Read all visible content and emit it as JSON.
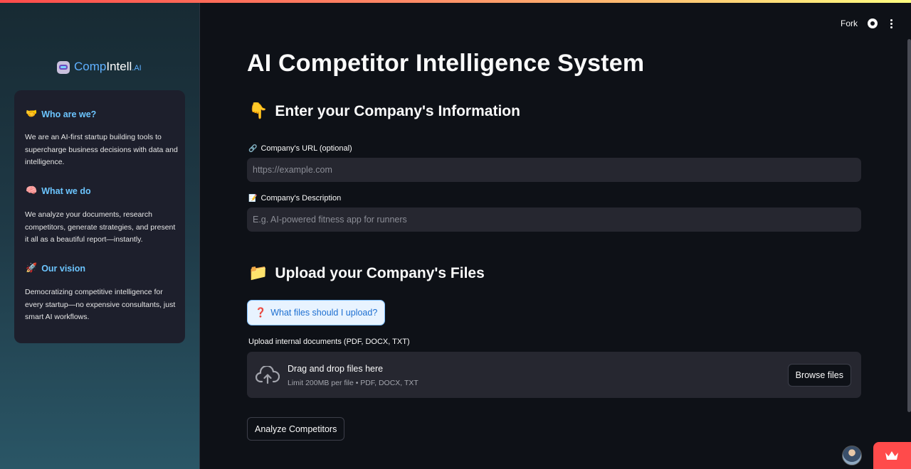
{
  "window": {
    "accent_bar_colors": [
      "#ff4b4b",
      "#fffd80"
    ]
  },
  "header": {
    "fork_label": "Fork",
    "github_icon": "github-icon",
    "menu_icon": "more-vertical-icon"
  },
  "sidebar": {
    "logo": {
      "comp": "Comp",
      "intell": "Intell",
      "ai": ".AI"
    },
    "sections": [
      {
        "emoji": "🤝",
        "heading": "Who are we?",
        "text": "We are an AI-first startup building tools to supercharge business decisions with data and intelligence."
      },
      {
        "emoji": "🧠",
        "heading": "What we do",
        "text": "We analyze your documents, research competitors, generate strategies, and present it all as a beautiful report—instantly."
      },
      {
        "emoji": "🚀",
        "heading": "Our vision",
        "text": "Democratizing competitive intelligence for every startup—no expensive consultants, just smart AI workflows."
      }
    ]
  },
  "main": {
    "title": "AI Competitor Intelligence System",
    "info_section": {
      "emoji": "👇",
      "title": "Enter your Company's Information"
    },
    "url_field": {
      "emoji": "🔗",
      "label": "Company's URL (optional)",
      "placeholder": "https://example.com",
      "value": ""
    },
    "desc_field": {
      "emoji": "📝",
      "label": "Company's Description",
      "placeholder": "E.g. AI-powered fitness app for runners",
      "value": ""
    },
    "upload_section": {
      "emoji": "📁",
      "title": "Upload your Company's Files"
    },
    "help_button": {
      "emoji": "❓",
      "label": "What files should I upload?"
    },
    "uploader": {
      "label": "Upload internal documents (PDF, DOCX, TXT)",
      "drop_title": "Drag and drop files here",
      "drop_sub": "Limit 200MB per file • PDF, DOCX, TXT",
      "browse_label": "Browse files"
    },
    "analyze_label": "Analyze Competitors"
  },
  "colors": {
    "accent_blue": "#6cc5ff",
    "primary_red": "#ff4b4b",
    "bg": "#0e1117",
    "input_bg": "#262730"
  }
}
